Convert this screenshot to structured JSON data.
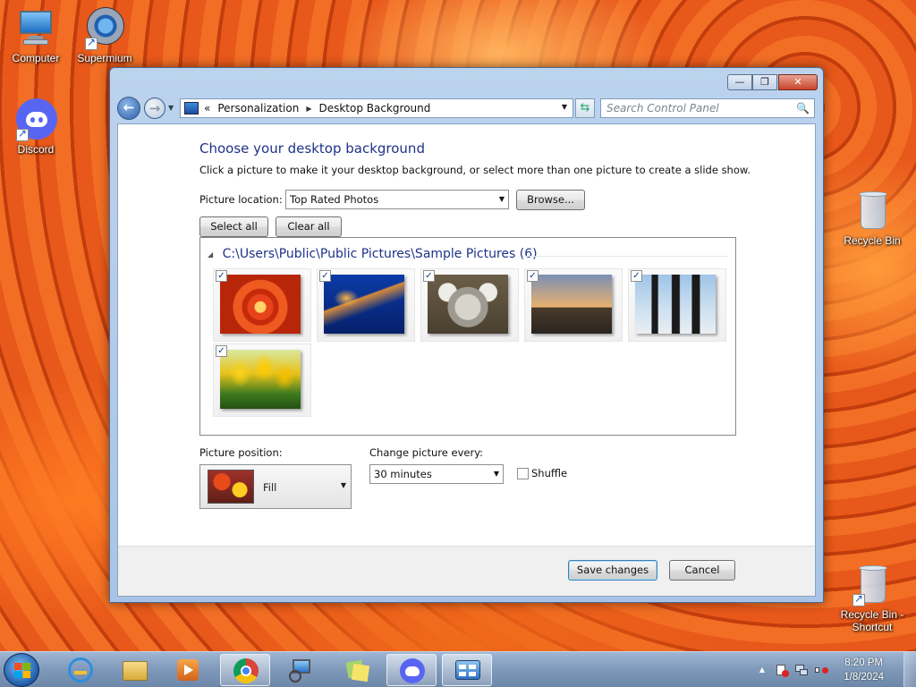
{
  "desktop": {
    "icons": [
      {
        "label": "Computer"
      },
      {
        "label": "Supermium"
      },
      {
        "label": "Discord"
      },
      {
        "label": "Recycle Bin"
      },
      {
        "label": "Recycle Bin - Shortcut"
      }
    ]
  },
  "window": {
    "buttons": {
      "minimize": "—",
      "restore": "❐",
      "close": "✕"
    },
    "breadcrumb": {
      "chevrons": "«",
      "items": [
        "Personalization",
        "Desktop Background"
      ],
      "separator": "▶"
    },
    "search": {
      "placeholder": "Search Control Panel",
      "icon": "🔍"
    }
  },
  "page": {
    "title": "Choose your desktop background",
    "subtitle": "Click a picture to make it your desktop background, or select more than one picture to create a slide show.",
    "picture_location": {
      "label": "Picture location:",
      "value": "Top Rated Photos"
    },
    "browse_label": "Browse...",
    "select_all_label": "Select all",
    "clear_all_label": "Clear all",
    "group": {
      "title": "C:\\Users\\Public\\Public Pictures\\Sample Pictures (6)",
      "collapse_glyph": "◢",
      "pictures": [
        {
          "name": "Chrysanthemum",
          "checked": true
        },
        {
          "name": "Jellyfish",
          "checked": true
        },
        {
          "name": "Koala",
          "checked": true
        },
        {
          "name": "Lighthouse",
          "checked": true
        },
        {
          "name": "Penguins",
          "checked": true
        },
        {
          "name": "Tulips",
          "checked": true
        }
      ],
      "check_glyph": "✓"
    },
    "picture_position": {
      "label": "Picture position:",
      "value": "Fill"
    },
    "change_every": {
      "label": "Change picture every:",
      "value": "30 minutes"
    },
    "shuffle": {
      "label": "Shuffle",
      "checked": false
    },
    "save_label": "Save changes",
    "cancel_label": "Cancel"
  },
  "taskbar": {
    "clock": {
      "time": "8:20 PM",
      "date": "1/8/2024"
    },
    "tray_up_glyph": "▲"
  },
  "colors": {
    "accent_title": "#1e3287",
    "taskbar": "#7f99ba"
  }
}
